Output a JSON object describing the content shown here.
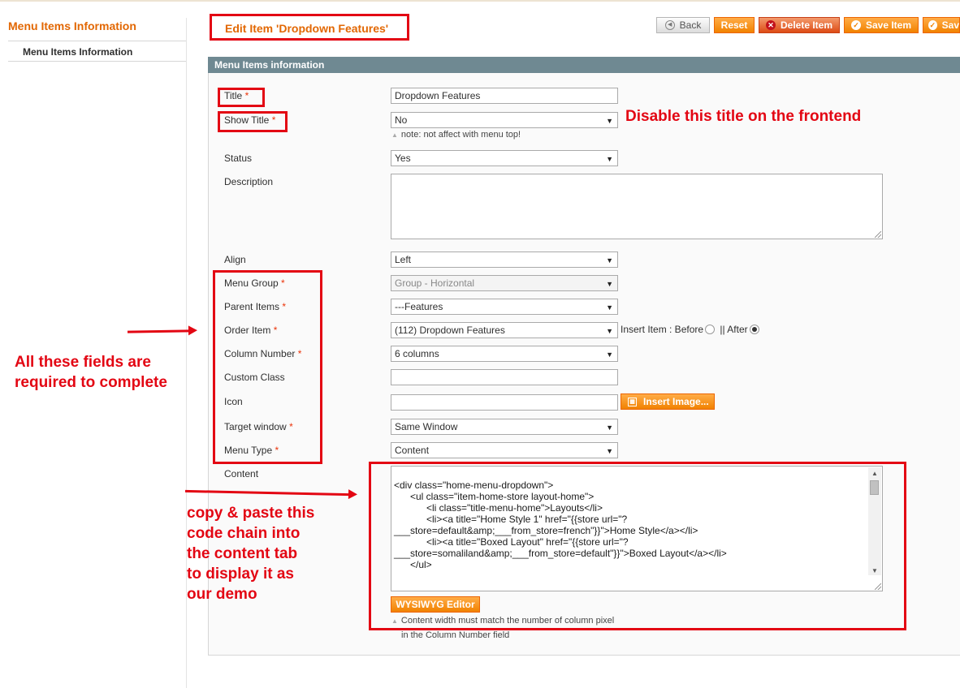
{
  "sidebar": {
    "title": "Menu Items Information",
    "items": [
      {
        "label": "Menu Items Information"
      }
    ]
  },
  "header": {
    "title": "Edit Item 'Dropdown Features'",
    "buttons": {
      "back": "Back",
      "reset": "Reset",
      "delete": "Delete Item",
      "save": "Save Item",
      "save_continue": "Sav"
    }
  },
  "section": {
    "title": "Menu Items information"
  },
  "form": {
    "required_mark": "*",
    "title": {
      "label": "Title",
      "value": "Dropdown Features"
    },
    "show_title": {
      "label": "Show Title",
      "value": "No",
      "note": "note: not affect with menu top!"
    },
    "status": {
      "label": "Status",
      "value": "Yes"
    },
    "description": {
      "label": "Description",
      "value": ""
    },
    "align": {
      "label": "Align",
      "value": "Left"
    },
    "menu_group": {
      "label": "Menu Group",
      "value": "Group - Horizontal"
    },
    "parent_items": {
      "label": "Parent Items",
      "value": "---Features"
    },
    "order_item": {
      "label": "Order Item",
      "value": "(112) Dropdown Features",
      "insert_label": "Insert Item : Before",
      "after_label": "|| After",
      "selected": "After"
    },
    "column_number": {
      "label": "Column Number",
      "value": "6 columns"
    },
    "custom_class": {
      "label": "Custom Class",
      "value": ""
    },
    "icon": {
      "label": "Icon",
      "value": "",
      "button": "Insert Image..."
    },
    "target_window": {
      "label": "Target window",
      "value": "Same Window"
    },
    "menu_type": {
      "label": "Menu Type",
      "value": "Content"
    },
    "content": {
      "label": "Content",
      "lines": [
        "<div class=\"home-menu-dropdown\">",
        "      <ul class=\"item-home-store layout-home\">",
        "            <li class=\"title-menu-home\">Layouts</li>",
        "            <li><a title=\"Home Style 1\" href=\"{{store url=\"?",
        "___store=default&amp;___from_store=french\"}}\">Home Style</a></li>",
        "            <li><a title=\"Boxed Layout\" href=\"{{store url=\"?",
        "___store=somaliland&amp;___from_store=default\"}}\">Boxed Layout</a></li>",
        "      </ul>"
      ],
      "editor_button": "WYSIWYG Editor",
      "note_line1": "Content width must match the number of column pixel",
      "note_line2": "in the Column Number field"
    }
  },
  "annotations": {
    "disable_title": "Disable this title on the frontend",
    "required_line1": "All these fields are",
    "required_line2": "required to complete",
    "copy_lines": [
      "copy & paste this",
      "code chain into",
      "the content tab",
      "to display it as",
      "our demo"
    ],
    "color": "#e30613"
  },
  "colors": {
    "accent": "#e26703",
    "button": "#f18200",
    "section_header": "#6f8992",
    "required": "#eb340a"
  }
}
